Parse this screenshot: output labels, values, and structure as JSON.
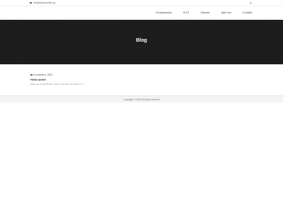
{
  "topbar": {
    "email": "info@pelecamfoto.gt",
    "social_icon": "facebook-icon",
    "social_glyph": "f"
  },
  "nav": {
    "items": [
      "Fényképezés",
      "HITS",
      "Zálokas",
      "Apki mui",
      "Kontakt"
    ]
  },
  "hero": {
    "title": "Blog"
  },
  "post": {
    "date": "8 november, 2022",
    "title": "Hello world!",
    "excerpt": "Welcome to WordPress. This is your first post. Edit or [...]"
  },
  "footer": {
    "copyright": "Copyright © 2022 All rights reserved"
  }
}
